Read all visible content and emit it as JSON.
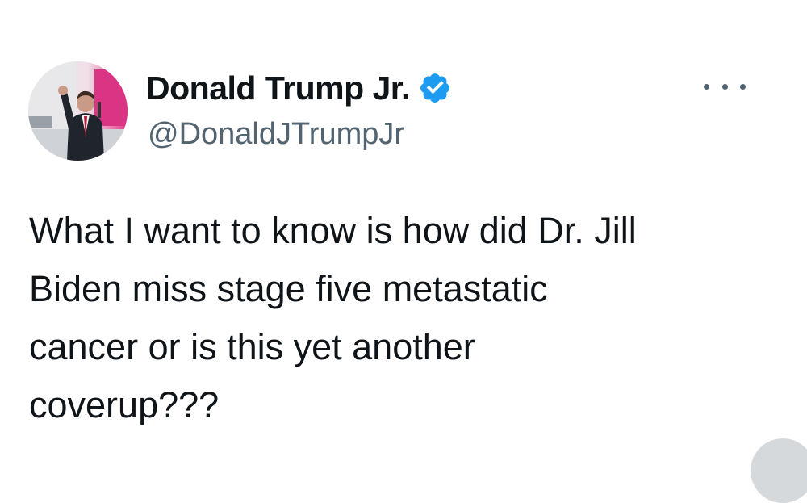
{
  "tweet": {
    "author": {
      "display_name": "Donald Trump Jr.",
      "handle": "@DonaldJTrumpJr",
      "verified": true,
      "avatar_icon": "profile-photo"
    },
    "more_icon": "ellipsis-icon",
    "text_lines": [
      "What I want to know is how did Dr. Jill",
      "Biden miss stage five metastatic",
      "cancer or is this yet another",
      "coverup???"
    ]
  },
  "colors": {
    "verified_blue": "#1d9bf0",
    "text_primary": "#0f1419",
    "text_secondary": "#536471"
  }
}
